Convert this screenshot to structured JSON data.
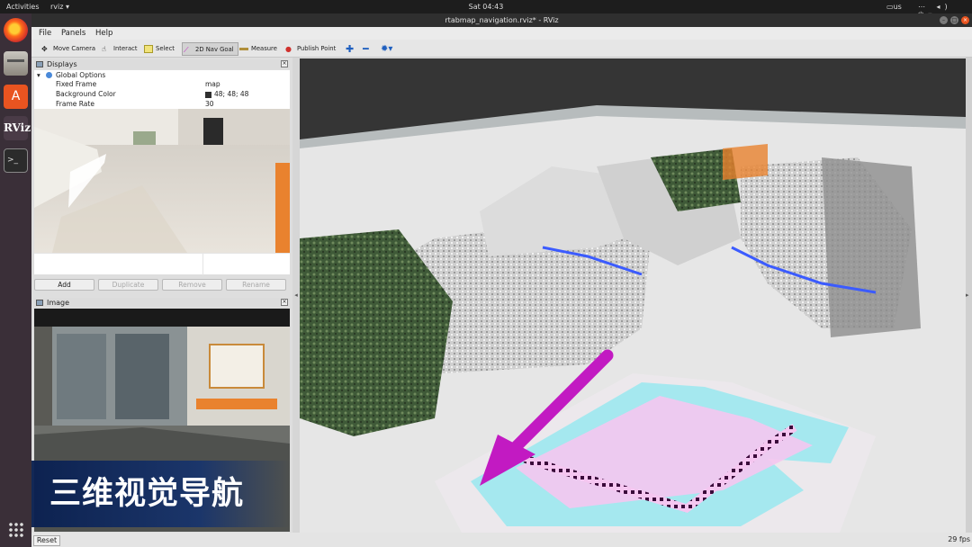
{
  "topbar": {
    "activities": "Activities",
    "app_menu": "rviz ▾",
    "clock": "Sat 04:43",
    "keyboard": "us",
    "system_icons": "⋯"
  },
  "window": {
    "title": "rtabmap_navigation.rviz* - RViz"
  },
  "menu": [
    "File",
    "Panels",
    "Help"
  ],
  "toolbar": [
    {
      "label": "Move Camera",
      "icon": "move-camera-icon"
    },
    {
      "label": "Interact",
      "icon": "interact-icon"
    },
    {
      "label": "Select",
      "icon": "select-icon"
    },
    {
      "label": "2D Nav Goal",
      "icon": "nav-goal-icon",
      "active": true
    },
    {
      "label": "Measure",
      "icon": "measure-icon"
    },
    {
      "label": "Publish Point",
      "icon": "publish-point-icon"
    }
  ],
  "displays": {
    "title": "Displays",
    "group": "Global Options",
    "properties": [
      {
        "key": "Fixed Frame",
        "value": "map"
      },
      {
        "key": "Background Color",
        "value": "48; 48; 48",
        "swatch": "#303030"
      },
      {
        "key": "Frame Rate",
        "value": "30"
      }
    ],
    "buttons": {
      "add": "Add",
      "duplicate": "Duplicate",
      "remove": "Remove",
      "rename": "Rename"
    }
  },
  "image_panel": {
    "title": "Image"
  },
  "caption": "三维视觉导航",
  "status": {
    "reset": "Reset",
    "fps": "29 fps"
  },
  "colors": {
    "nav_arrow": "#c21ac2",
    "cost_inflation": "#8ee8f0",
    "obstacle": "#3a0a3a"
  }
}
